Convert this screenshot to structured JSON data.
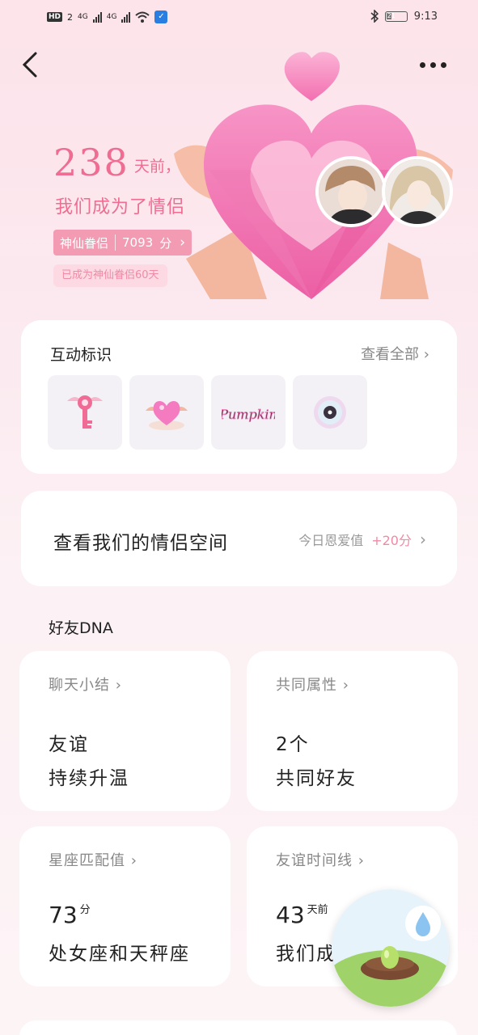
{
  "status_bar": {
    "hd_label": "HD",
    "sim1": "2",
    "net1": "4G",
    "net2": "4G",
    "battery": "21",
    "time": "9:13"
  },
  "hero": {
    "days": "238",
    "days_unit": "天前，",
    "became": "我们成为了情侣",
    "tier_name": "神仙眷侣",
    "tier_points": "7093",
    "tier_points_unit": "分",
    "tier_note": "已成为神仙眷侣60天"
  },
  "badges": {
    "title": "互动标识",
    "view_all": "查看全部",
    "items": [
      {
        "icon": "winged-key-icon"
      },
      {
        "icon": "winged-heart-icon"
      },
      {
        "icon": "pumpkin-text-badge",
        "text": "Pumpkin"
      },
      {
        "icon": "vinyl-disc-icon"
      }
    ]
  },
  "space": {
    "title": "查看我们的情侣空间",
    "today_label": "今日恩爱值",
    "today_points": "+20分"
  },
  "dna": {
    "section_title": "好友DNA",
    "cards": [
      {
        "label": "聊天小结",
        "line1": "友谊",
        "line2": "持续升温"
      },
      {
        "label": "共同属性",
        "line1": "2个",
        "line2": "共同好友"
      },
      {
        "label": "星座匹配值",
        "num": "73",
        "num_unit": "分",
        "line2": "处女座和天秤座"
      },
      {
        "label": "友谊时间线",
        "num": "43",
        "num_unit": "天前",
        "line2": "我们成"
      }
    ]
  },
  "colors": {
    "accent": "#ef6c92",
    "pill": "#f29bb2",
    "card_bg": "#ffffff"
  }
}
